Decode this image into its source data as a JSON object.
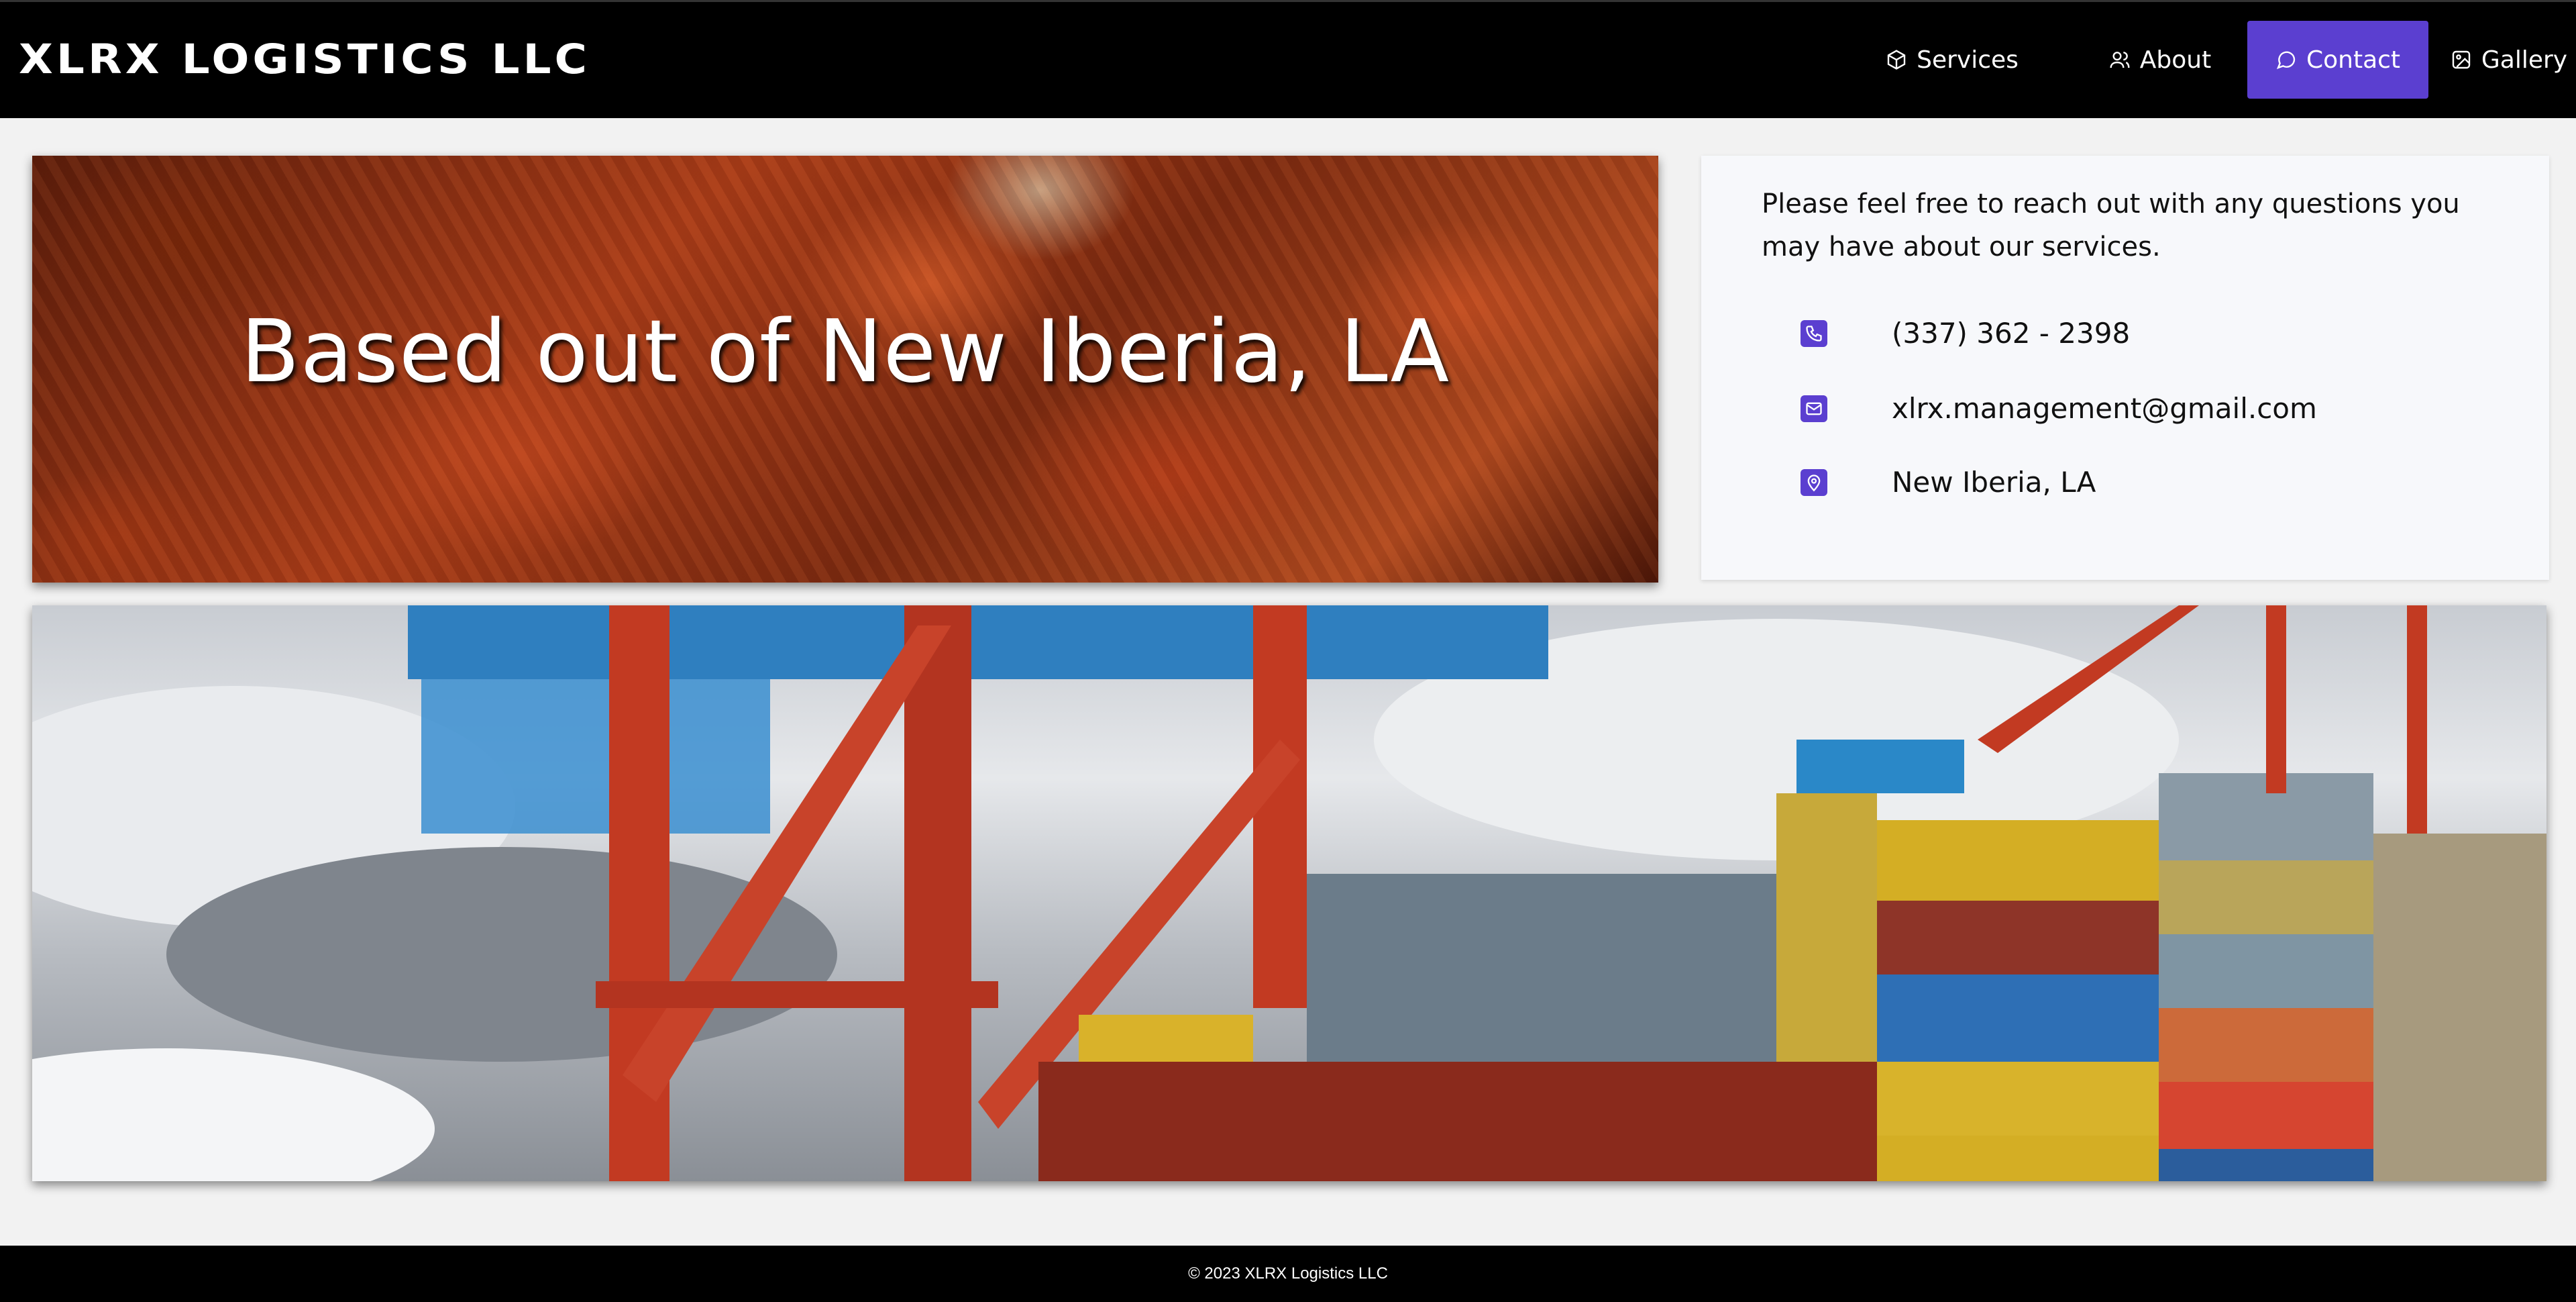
{
  "header": {
    "logo": "XLRX LOGISTICS LLC",
    "nav": [
      {
        "label": "Services",
        "icon": "box-icon"
      },
      {
        "label": "About",
        "icon": "users-icon"
      },
      {
        "label": "Contact",
        "icon": "chat-icon",
        "active": true
      },
      {
        "label": "Gallery",
        "icon": "image-icon"
      }
    ],
    "accent": "#5b3fd0"
  },
  "banner": {
    "title": "Based out of New Iberia, LA"
  },
  "contact": {
    "intro": "Please feel free to reach out with any questions you may have about our services.",
    "phone": "(337) 362 - 2398",
    "email": "xlrx.management@gmail.com",
    "location": "New Iberia, LA"
  },
  "footer": {
    "copyright": "© 2023 XLRX Logistics LLC"
  }
}
